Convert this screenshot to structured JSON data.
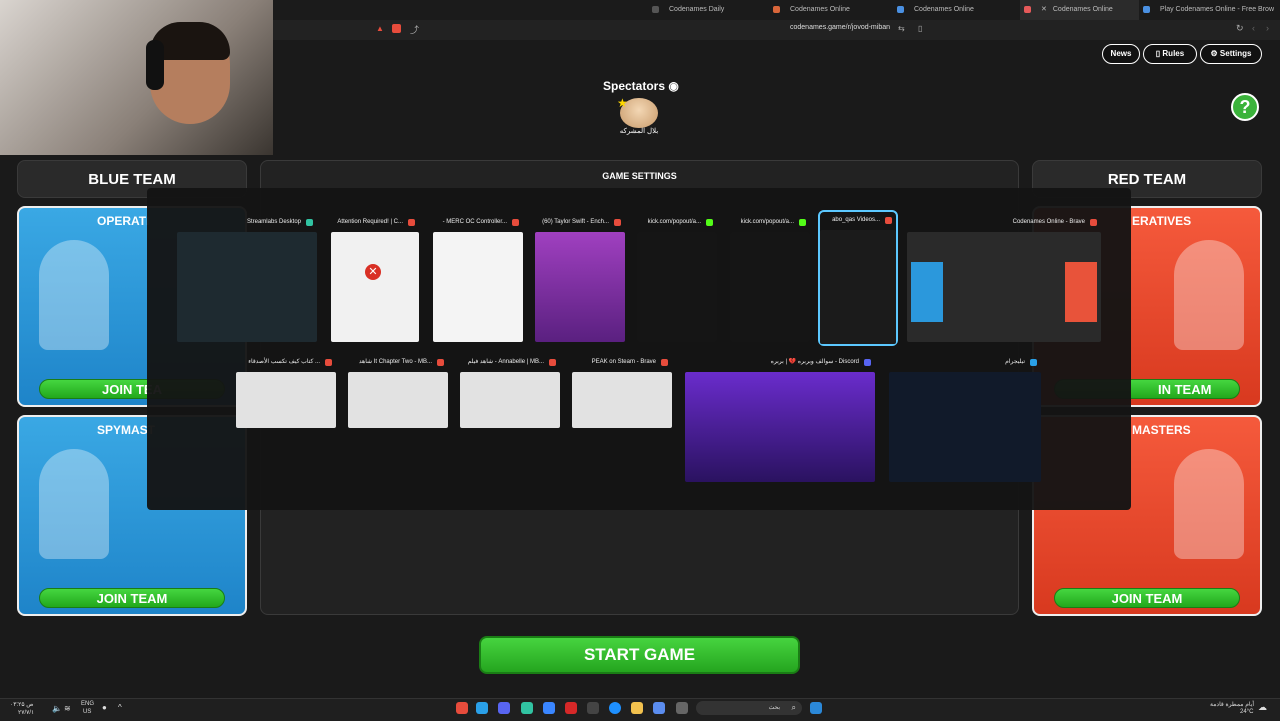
{
  "browser": {
    "tabs": [
      {
        "label": "Codenames Daily",
        "active": false
      },
      {
        "label": "Codenames Online",
        "active": false
      },
      {
        "label": "Codenames Online",
        "active": false
      },
      {
        "label": "Codenames Online",
        "active": true
      },
      {
        "label": "Play Codenames Online - Free Brow",
        "active": false
      }
    ],
    "url": "codenames.game/r/jovod-miban"
  },
  "header": {
    "news": "News",
    "rules": "Rules",
    "settings": "Settings",
    "help": "?"
  },
  "spectators": {
    "title": "Spectators",
    "user_name": "بلال المشركه"
  },
  "blue_team": {
    "title": "BLUE TEAM",
    "operatives": "OPERATI",
    "operatives_join": "JOIN TEA",
    "spymasters": "SPYMAST",
    "spymasters_join": "JOIN TEAM"
  },
  "red_team": {
    "title": "RED TEAM",
    "operatives": "ERATIVES",
    "operatives_join": "IN TEAM",
    "spymasters": "MASTERS",
    "spymasters_join": "JOIN TEAM"
  },
  "center": {
    "title": "GAME SETTINGS"
  },
  "start_button": "START GAME",
  "window_switcher": {
    "row1": [
      {
        "title": "Streamlabs Desktop",
        "icon_color": "#31c3a2",
        "thumb": "#1e2a30"
      },
      {
        "title": "Attention Required! | C...",
        "icon_color": "#e74c3c",
        "thumb": "#f1f1f1"
      },
      {
        "title": "- MERC OC Controller...",
        "icon_color": "#e74c3c",
        "thumb": "#f4f4f4"
      },
      {
        "title": "(60) Taylor Swift - Ench...",
        "icon_color": "#e74c3c",
        "thumb": "#8a3fb0"
      },
      {
        "title": "kick.com/popout/a...",
        "icon_color": "#53fc18",
        "thumb": "#151515"
      },
      {
        "title": "kick.com/popout/a...",
        "icon_color": "#53fc18",
        "thumb": "#151515"
      },
      {
        "title": "abo_qas Videos...",
        "icon_color": "#e74c3c",
        "thumb": "#1b1b1b"
      },
      {
        "title": "Codenames Online - Brave",
        "icon_color": "#e74c3c",
        "thumb": "#2a2a2a"
      }
    ],
    "row2": [
      {
        "title": "كتاب كيف تكسب الأصدقاء ...",
        "icon_color": "#e74c3c",
        "thumb": "#e2e2e2"
      },
      {
        "title": "شاهد It Chapter Two - MB...",
        "icon_color": "#e74c3c",
        "thumb": "#e2e2e2"
      },
      {
        "title": "شاهد فيلم - Annabelle | MB...",
        "icon_color": "#e74c3c",
        "thumb": "#e2e2e2"
      },
      {
        "title": "PEAK on Steam - Brave",
        "icon_color": "#e74c3c",
        "thumb": "#e2e2e2"
      },
      {
        "title": "سوالف وبربره 💔 | بربره - Discord",
        "icon_color": "#5865f2",
        "thumb": "#3b1f7a"
      },
      {
        "title": "تيليجرام",
        "icon_color": "#2aa0e8",
        "thumb": "#111a2a"
      }
    ]
  },
  "taskbar": {
    "search_placeholder": "بحث",
    "weather_text": "أيام ممطرة قادمة",
    "temperature": "24°C",
    "lang": "ENG",
    "region": "US",
    "time": "۰۳:۲۵ ص",
    "date": "۲۷/۷/۱"
  }
}
